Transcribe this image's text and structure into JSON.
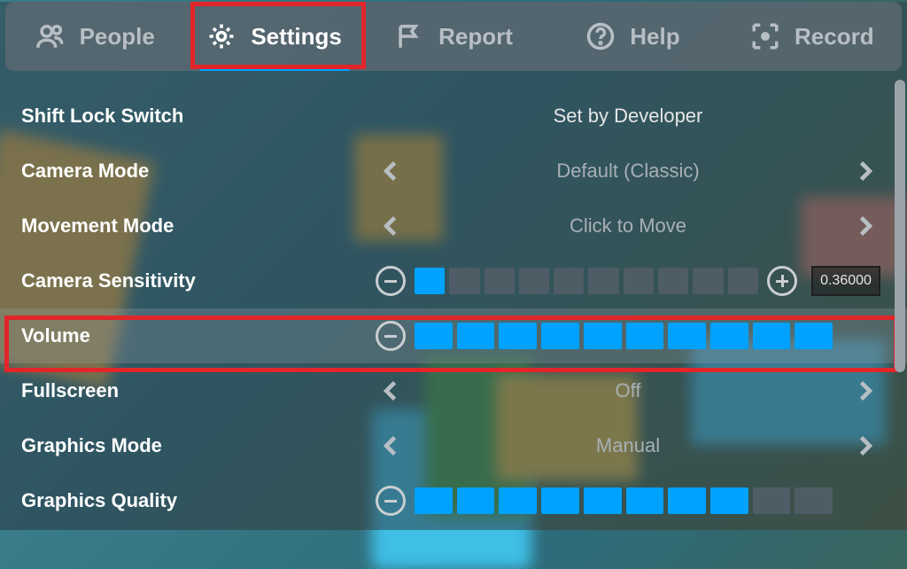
{
  "tabs": {
    "people": "People",
    "settings": "Settings",
    "report": "Report",
    "help": "Help",
    "record": "Record",
    "active": "settings"
  },
  "settings": {
    "shift_lock": {
      "label": "Shift Lock Switch",
      "value": "Set by Developer"
    },
    "camera_mode": {
      "label": "Camera Mode",
      "value": "Default (Classic)"
    },
    "movement_mode": {
      "label": "Movement Mode",
      "value": "Click to Move"
    },
    "camera_sensitivity": {
      "label": "Camera Sensitivity",
      "filled": 1,
      "total": 10,
      "value_text": "0.36000",
      "show_plus": true,
      "show_value": true
    },
    "volume": {
      "label": "Volume",
      "filled": 10,
      "total": 10
    },
    "fullscreen": {
      "label": "Fullscreen",
      "value": "Off"
    },
    "graphics_mode": {
      "label": "Graphics Mode",
      "value": "Manual"
    },
    "graphics_quality": {
      "label": "Graphics Quality",
      "filled": 8,
      "total": 10
    }
  },
  "colors": {
    "accent": "#00a2ff",
    "highlight": "#e1262a"
  }
}
